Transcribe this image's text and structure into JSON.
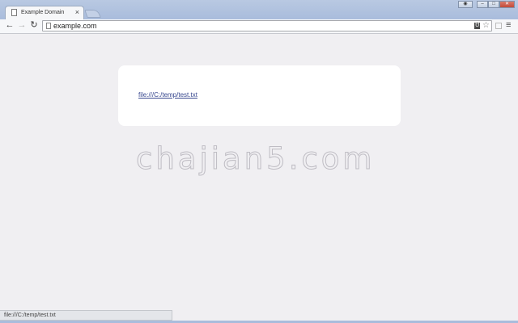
{
  "tab": {
    "title": "Example Domain",
    "close": "×"
  },
  "toolbar": {
    "back": "←",
    "forward": "→",
    "reload": "↻",
    "url": "example.com",
    "translate": "Ꮜ",
    "star": "☆",
    "menu": "≡"
  },
  "window_controls": {
    "user": "◉",
    "minimize": "–",
    "maximize": "□",
    "close": "✕"
  },
  "page": {
    "link": "file:///C:/temp/test.txt"
  },
  "watermark": "chajian5.com",
  "status": {
    "text": "file:///C:/temp/test.txt"
  }
}
